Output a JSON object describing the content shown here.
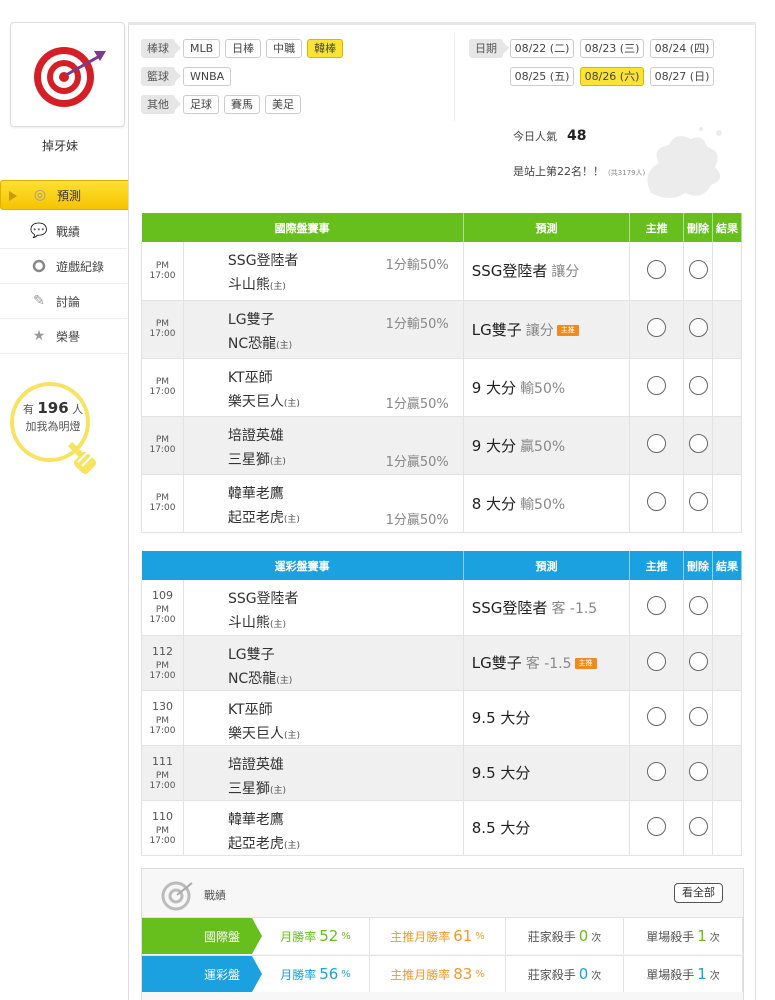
{
  "user": {
    "name": "掉牙妹"
  },
  "sidebar": {
    "items": [
      {
        "label": "預測",
        "icon": "target-icon",
        "active": true
      },
      {
        "label": "戰績",
        "icon": "chat-icon"
      },
      {
        "label": "遊戲紀錄",
        "icon": "ring-icon"
      },
      {
        "label": "討論",
        "icon": "pencil-icon"
      },
      {
        "label": "榮譽",
        "icon": "medal-icon"
      }
    ],
    "fans": {
      "prefix": "有",
      "count": "196",
      "suffix": "人",
      "line2": "加我為明燈"
    }
  },
  "sports": {
    "rows": [
      {
        "category": "棒球",
        "items": [
          "MLB",
          "日棒",
          "中職",
          "韓棒"
        ],
        "selected": "韓棒"
      },
      {
        "category": "籃球",
        "items": [
          "WNBA"
        ]
      },
      {
        "category": "其他",
        "items": [
          "足球",
          "賽馬",
          "美足"
        ]
      }
    ]
  },
  "dates": {
    "label": "日期",
    "row1": [
      "08/22 (二)",
      "08/23 (三)",
      "08/24 (四)"
    ],
    "row2": [
      "08/25 (五)",
      "08/26 (六)",
      "08/27 (日)"
    ],
    "selected": "08/26 (六)"
  },
  "stats": {
    "popularity_label": "今日人氣",
    "popularity": "48",
    "rank_text": "是站上第22名！！",
    "rank_note": "(共3179人)"
  },
  "international": {
    "headers": [
      "國際盤賽事",
      "預測",
      "主推",
      "刪除",
      "結果"
    ],
    "rows": [
      {
        "time": "PM 17:00",
        "team1": "SSG登陸者",
        "team2": "斗山熊",
        "home": "(主)",
        "odds": "1分輸50%",
        "odds_pos": "top",
        "pick": "SSG登陸者",
        "pick_detail": "讓分",
        "featured": false
      },
      {
        "time": "PM 17:00",
        "team1": "LG雙子",
        "team2": "NC恐龍",
        "home": "(主)",
        "odds": "1分輸50%",
        "odds_pos": "top",
        "pick": "LG雙子",
        "pick_detail": "讓分",
        "featured": true
      },
      {
        "time": "PM 17:00",
        "team1": "KT巫師",
        "team2": "樂天巨人",
        "home": "(主)",
        "odds": "1分贏50%",
        "odds_pos": "bottom",
        "pick": "9 大分",
        "pick_detail": "輸50%",
        "featured": false
      },
      {
        "time": "PM 17:00",
        "team1": "培證英雄",
        "team2": "三星獅",
        "home": "(主)",
        "odds": "1分贏50%",
        "odds_pos": "bottom",
        "pick": "9 大分",
        "pick_detail": "贏50%",
        "featured": false
      },
      {
        "time": "PM 17:00",
        "team1": "韓華老鷹",
        "team2": "起亞老虎",
        "home": "(主)",
        "odds": "1分贏50%",
        "odds_pos": "bottom",
        "pick": "8 大分",
        "pick_detail": "輸50%",
        "featured": false
      }
    ]
  },
  "sports_lottery": {
    "headers": [
      "運彩盤賽事",
      "預測",
      "主推",
      "刪除",
      "結果"
    ],
    "rows": [
      {
        "no": "109",
        "time": "PM 17:00",
        "team1": "SSG登陸者",
        "team2": "斗山熊",
        "home": "(主)",
        "pick": "SSG登陸者",
        "pick_detail": "客 -1.5",
        "featured": false
      },
      {
        "no": "112",
        "time": "PM 17:00",
        "team1": "LG雙子",
        "team2": "NC恐龍",
        "home": "(主)",
        "pick": "LG雙子",
        "pick_detail": "客 -1.5",
        "featured": true
      },
      {
        "no": "130",
        "time": "PM 17:00",
        "team1": "KT巫師",
        "team2": "樂天巨人",
        "home": "(主)",
        "pick": "9.5 大分",
        "pick_detail": "",
        "featured": false
      },
      {
        "no": "111",
        "time": "PM 17:00",
        "team1": "培證英雄",
        "team2": "三星獅",
        "home": "(主)",
        "pick": "9.5 大分",
        "pick_detail": "",
        "featured": false
      },
      {
        "no": "110",
        "time": "PM 17:00",
        "team1": "韓華老鷹",
        "team2": "起亞老虎",
        "home": "(主)",
        "pick": "8.5 大分",
        "pick_detail": "",
        "featured": false
      }
    ]
  },
  "featured_tag": "主推",
  "record": {
    "title": "戰績",
    "all_button": "看全部",
    "rows": [
      {
        "label": "國際盤",
        "color": "#66bf1c",
        "monthly_label": "月勝率",
        "monthly": "52",
        "feat_label": "主推月勝率",
        "feat": "61",
        "bookie_label": "莊家殺手",
        "bookie": "0",
        "single_label": "單場殺手",
        "single": "1",
        "pct": "%",
        "times": "次"
      },
      {
        "label": "運彩盤",
        "color": "#1ba0e0",
        "monthly_label": "月勝率",
        "monthly": "56",
        "feat_label": "主推月勝率",
        "feat": "83",
        "bookie_label": "莊家殺手",
        "bookie": "0",
        "single_label": "單場殺手",
        "single": "1",
        "pct": "%",
        "times": "次"
      }
    ]
  },
  "colors": {
    "green": "#66bf1c",
    "blue": "#1ba0e0",
    "yellow": "#fbe431",
    "orange": "#f08a1c",
    "featured_num": "#f09a2c"
  }
}
